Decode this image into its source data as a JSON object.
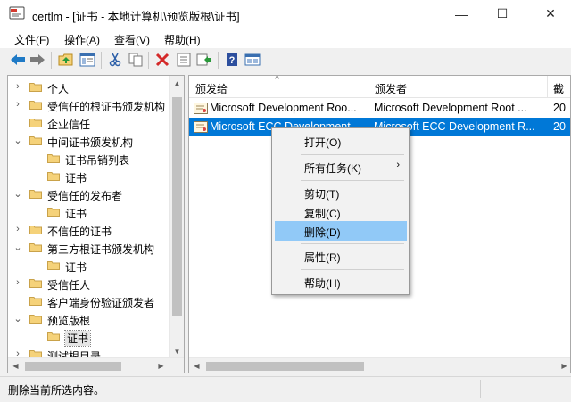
{
  "window": {
    "title": "certlm - [证书 - 本地计算机\\预览版根\\证书]",
    "minimize_glyph": "—",
    "maximize_glyph": "☐",
    "close_glyph": "✕"
  },
  "menubar": {
    "items": [
      "文件(F)",
      "操作(A)",
      "查看(V)",
      "帮助(H)"
    ]
  },
  "toolbar": {
    "icons": [
      "back-arrow-icon",
      "forward-arrow-icon",
      "up-folder-icon",
      "show-tree-icon",
      "cut-icon",
      "copy-icon",
      "delete-icon",
      "properties-icon",
      "export-icon",
      "help-icon",
      "mmc-view-icon"
    ]
  },
  "tree": {
    "items": [
      {
        "label": "个人",
        "arrow": "›",
        "indent": 0
      },
      {
        "label": "受信任的根证书颁发机构",
        "arrow": "›",
        "indent": 0
      },
      {
        "label": "企业信任",
        "arrow": "",
        "indent": 0
      },
      {
        "label": "中间证书颁发机构",
        "arrow": "⌄",
        "indent": 0
      },
      {
        "label": "证书吊销列表",
        "arrow": "",
        "indent": 1
      },
      {
        "label": "证书",
        "arrow": "",
        "indent": 1
      },
      {
        "label": "受信任的发布者",
        "arrow": "⌄",
        "indent": 0
      },
      {
        "label": "证书",
        "arrow": "",
        "indent": 1
      },
      {
        "label": "不信任的证书",
        "arrow": "›",
        "indent": 0
      },
      {
        "label": "第三方根证书颁发机构",
        "arrow": "⌄",
        "indent": 0
      },
      {
        "label": "证书",
        "arrow": "",
        "indent": 1
      },
      {
        "label": "受信任人",
        "arrow": "›",
        "indent": 0
      },
      {
        "label": "客户端身份验证颁发者",
        "arrow": "",
        "indent": 0
      },
      {
        "label": "预览版根",
        "arrow": "⌄",
        "indent": 0
      },
      {
        "label": "证书",
        "arrow": "",
        "indent": 1,
        "selected": true
      },
      {
        "label": "测试根目录",
        "arrow": "›",
        "indent": 0
      }
    ]
  },
  "list": {
    "columns": [
      "颁发给",
      "颁发者",
      "截"
    ],
    "sort_glyph": "^",
    "rows": [
      {
        "issued_to": "Microsoft Development Roo...",
        "issued_by": "Microsoft Development Root ...",
        "extra": "20",
        "selected": false
      },
      {
        "issued_to": "Microsoft ECC Development ...",
        "issued_by": "Microsoft ECC Development R...",
        "extra": "20",
        "selected": true
      }
    ]
  },
  "context_menu": {
    "items": [
      {
        "label": "打开(O)"
      },
      {
        "label": "所有任务(K)",
        "submenu": "›"
      },
      {
        "label": "剪切(T)"
      },
      {
        "label": "复制(C)"
      },
      {
        "label": "删除(D)",
        "hover": true
      },
      {
        "label": "属性(R)"
      },
      {
        "label": "帮助(H)"
      }
    ]
  },
  "statusbar": {
    "text": "删除当前所选内容。"
  },
  "scroll": {
    "up": "▲",
    "down": "▼",
    "left": "◀",
    "right": "▶"
  },
  "colors": {
    "selection": "#0078d7",
    "menu_hover": "#91c9f7",
    "folder": "#f5d27a",
    "delete_red": "#d42a2a",
    "help_blue": "#2d4f9e"
  }
}
